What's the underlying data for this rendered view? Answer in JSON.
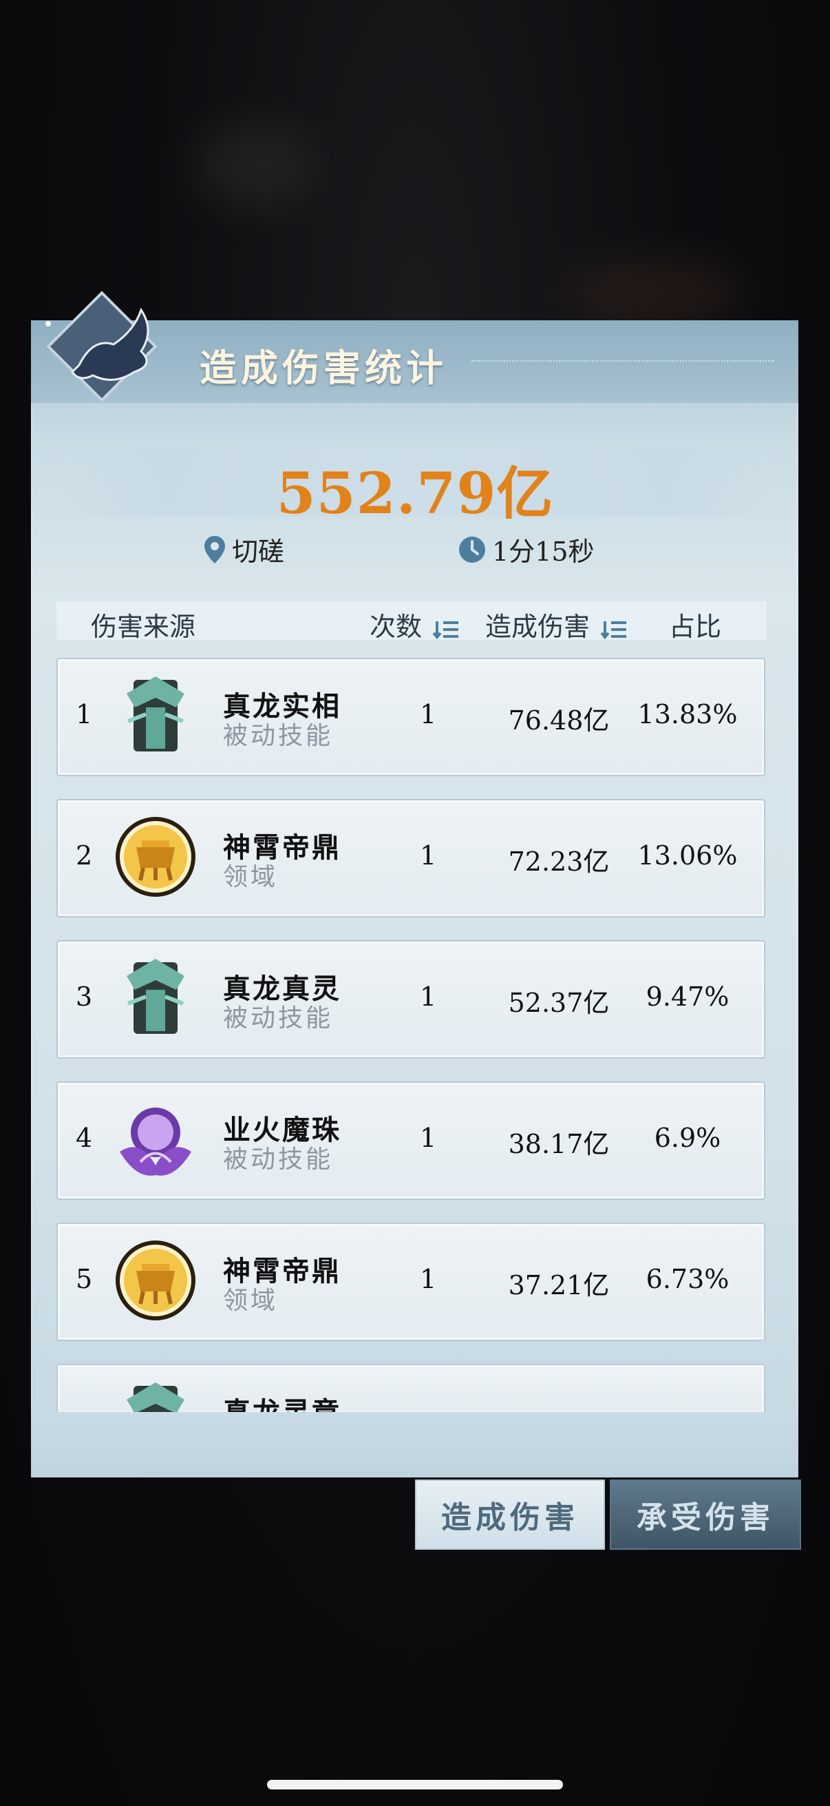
{
  "panel": {
    "title": "造成伤害统计",
    "total_damage": "552.79亿",
    "location": "切磋",
    "duration": "1分15秒"
  },
  "table": {
    "headers": {
      "source": "伤害来源",
      "count": "次数",
      "damage": "造成伤害",
      "ratio": "占比"
    },
    "rows": [
      {
        "rank": "1",
        "name": "真龙实相",
        "type": "被动技能",
        "count": "1",
        "damage": "76.48亿",
        "ratio": "13.83%",
        "icon": "dragon-totem-icon"
      },
      {
        "rank": "2",
        "name": "神霄帝鼎",
        "type": "领域",
        "count": "1",
        "damage": "72.23亿",
        "ratio": "13.06%",
        "icon": "golden-cauldron-icon"
      },
      {
        "rank": "3",
        "name": "真龙真灵",
        "type": "被动技能",
        "count": "1",
        "damage": "52.37亿",
        "ratio": "9.47%",
        "icon": "dragon-totem-icon"
      },
      {
        "rank": "4",
        "name": "业火魔珠",
        "type": "被动技能",
        "count": "1",
        "damage": "38.17亿",
        "ratio": "6.9%",
        "icon": "purple-lotus-orb-icon"
      },
      {
        "rank": "5",
        "name": "神霄帝鼎",
        "type": "领域",
        "count": "1",
        "damage": "37.21亿",
        "ratio": "6.73%",
        "icon": "golden-cauldron-icon"
      },
      {
        "rank": "",
        "name": "真龙灵章",
        "type": "",
        "count": "",
        "damage": "",
        "ratio": "",
        "icon": "dragon-totem-icon"
      }
    ]
  },
  "tabs": {
    "dealt": "造成伤害",
    "taken": "承受伤害"
  },
  "colors": {
    "total_value": "#e2821a",
    "tab_active_bg": "#e7f0f4",
    "tab_inactive_bg": "#4b6475"
  }
}
